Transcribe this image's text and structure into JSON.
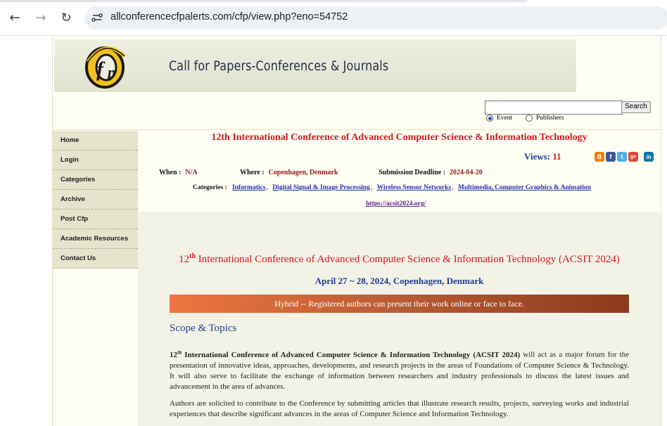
{
  "browser": {
    "url": "allconferencecfpalerts.com/cfp/view.php?eno=54752"
  },
  "header": {
    "logo_text": "cfp",
    "title": "Call for Papers-Conferences & Journals",
    "search_button": "Search",
    "search_value": "",
    "radio_event": "Event",
    "radio_publishers": "Publishers"
  },
  "sidebar": {
    "items": [
      {
        "label": "Home"
      },
      {
        "label": "Login"
      },
      {
        "label": "Categories"
      },
      {
        "label": "Archive"
      },
      {
        "label": "Post Cfp"
      },
      {
        "label": "Academic Resources"
      },
      {
        "label": "Contact Us"
      }
    ]
  },
  "conference": {
    "title": "12th International Conference of Advanced Computer Science & Information Technology",
    "views_label": "Views:",
    "views_count": "11",
    "when_label": "When :",
    "when_value": "N/A",
    "where_label": "Where :",
    "where_value": "Copenhagen, Denmark",
    "deadline_label": "Submission Deadline :",
    "deadline_value": "2024-04-20",
    "categories_label": "Categories :",
    "categories": [
      "Informatics",
      "Digital Signal & Image Processing",
      "Wireless Sensor Networks",
      "Multimedia, Computer Graphics & Animation"
    ],
    "website": "https://acsit2024.org/"
  },
  "social": [
    {
      "icon": "blogger-icon",
      "glyph": "B",
      "color": "#f57d00"
    },
    {
      "icon": "facebook-icon",
      "glyph": "f",
      "color": "#3b5998"
    },
    {
      "icon": "twitter-icon",
      "glyph": "t",
      "color": "#55acee"
    },
    {
      "icon": "googleplus-icon",
      "glyph": "g+",
      "color": "#dd4b39"
    },
    {
      "icon": "linkedin-icon",
      "glyph": "in",
      "color": "#0e76a8"
    }
  ],
  "description": {
    "heading_num": "12",
    "heading_sup": "th",
    "heading_rest": " International Conference of Advanced Computer Science & Information Technology (ACSIT 2024)",
    "date_line": "April 27 ~ 28, 2024, Copenhagen, Denmark",
    "hybrid_banner": "Hybrid -- Registered authors can present their work online or face to face.",
    "scope_heading": "Scope & Topics",
    "para1_num": "12",
    "para1_sup": "th",
    "para1_bold": " International Conference of Advanced Computer Science & Information Technology (ACSIT 2024)",
    "para1_rest": " will act as a major forum for the presentation of innovative ideas, approaches, developments, and research projects in the areas of Foundations of Computer Science & Technology. It will also serve to facilitate the exchange of information between researchers and industry professionals to discuss the latest issues and advancement in the area of advances.",
    "para2": "Authors are solicited to contribute to the Conference by submitting articles that illustrate research results, projects, surveying works and industrial experiences that describe significant advances in the areas of Computer Science and Information Technology."
  }
}
